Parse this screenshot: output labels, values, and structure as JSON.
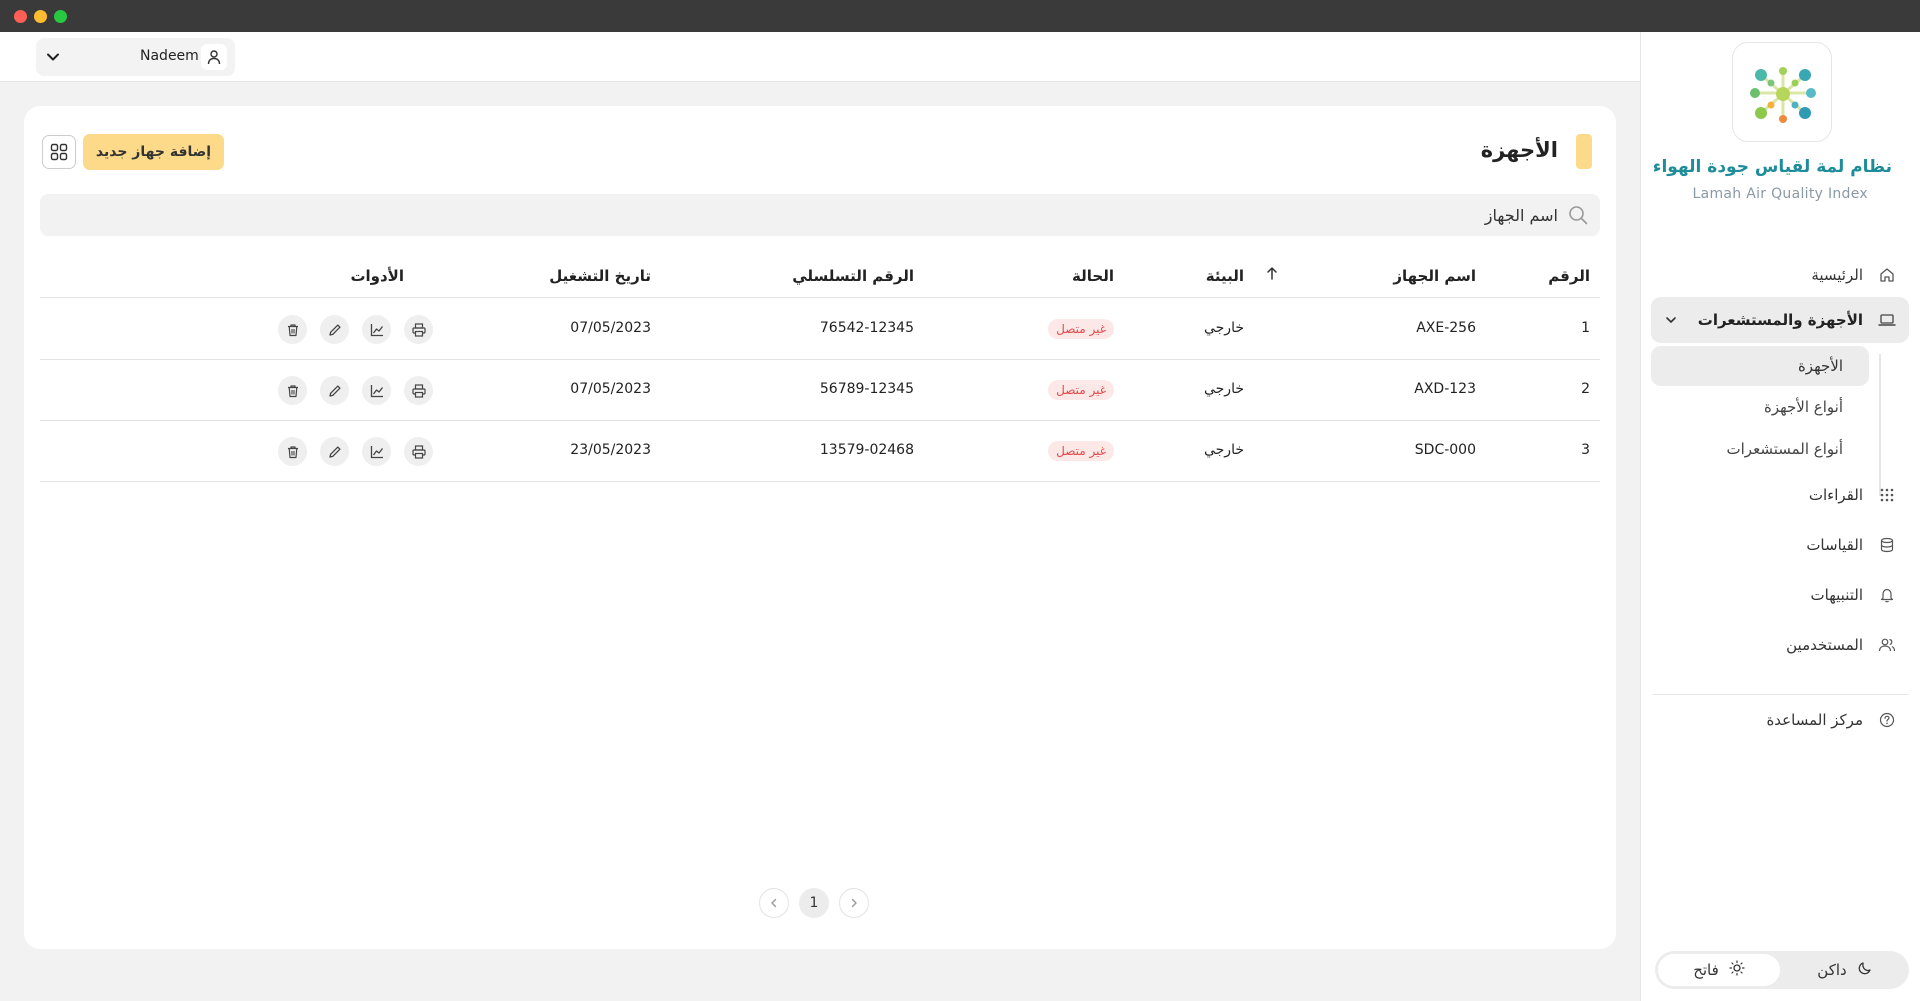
{
  "user": {
    "name": "Nadeem"
  },
  "brand": {
    "title": "نظام لمة لقياس جودة الهواء",
    "subtitle": "Lamah Air Quality Index"
  },
  "nav": {
    "home": "الرئيسية",
    "devices_sensors": "الأجهزة والمستشعرات",
    "sub_devices": "الأجهزة",
    "sub_device_types": "أنواع الأجهزة",
    "sub_sensor_types": "أنواع المستشعرات",
    "readings": "القراءات",
    "measurements": "القياسات",
    "alerts": "التنبيهات",
    "users": "المستخدمين",
    "help": "مركز المساعدة"
  },
  "theme": {
    "light": "فاتح",
    "dark": "داكن"
  },
  "page": {
    "title": "الأجهزة",
    "add_button": "إضافة جهاز جديد",
    "search_placeholder": "اسم الجهاز"
  },
  "table": {
    "headers": {
      "number": "الرقم",
      "name": "اسم الجهاز",
      "environment": "البيئة",
      "status": "الحالة",
      "serial": "الرقم التسلسلي",
      "date": "تاريخ التشغيل",
      "tools": "الأدوات"
    },
    "rows": [
      {
        "number": "1",
        "name": "AXE-256",
        "environment": "خارجي",
        "status": "غير متصل",
        "serial": "76542-12345",
        "date": "07/05/2023"
      },
      {
        "number": "2",
        "name": "AXD-123",
        "environment": "خارجي",
        "status": "غير متصل",
        "serial": "56789-12345",
        "date": "07/05/2023"
      },
      {
        "number": "3",
        "name": "SDC-000",
        "environment": "خارجي",
        "status": "غير متصل",
        "serial": "13579-02468",
        "date": "23/05/2023"
      }
    ]
  },
  "pagination": {
    "current": "1"
  },
  "colors": {
    "accent": "#fdd98a",
    "brand": "#1e8c99",
    "status_offline": "#e14b4b"
  }
}
